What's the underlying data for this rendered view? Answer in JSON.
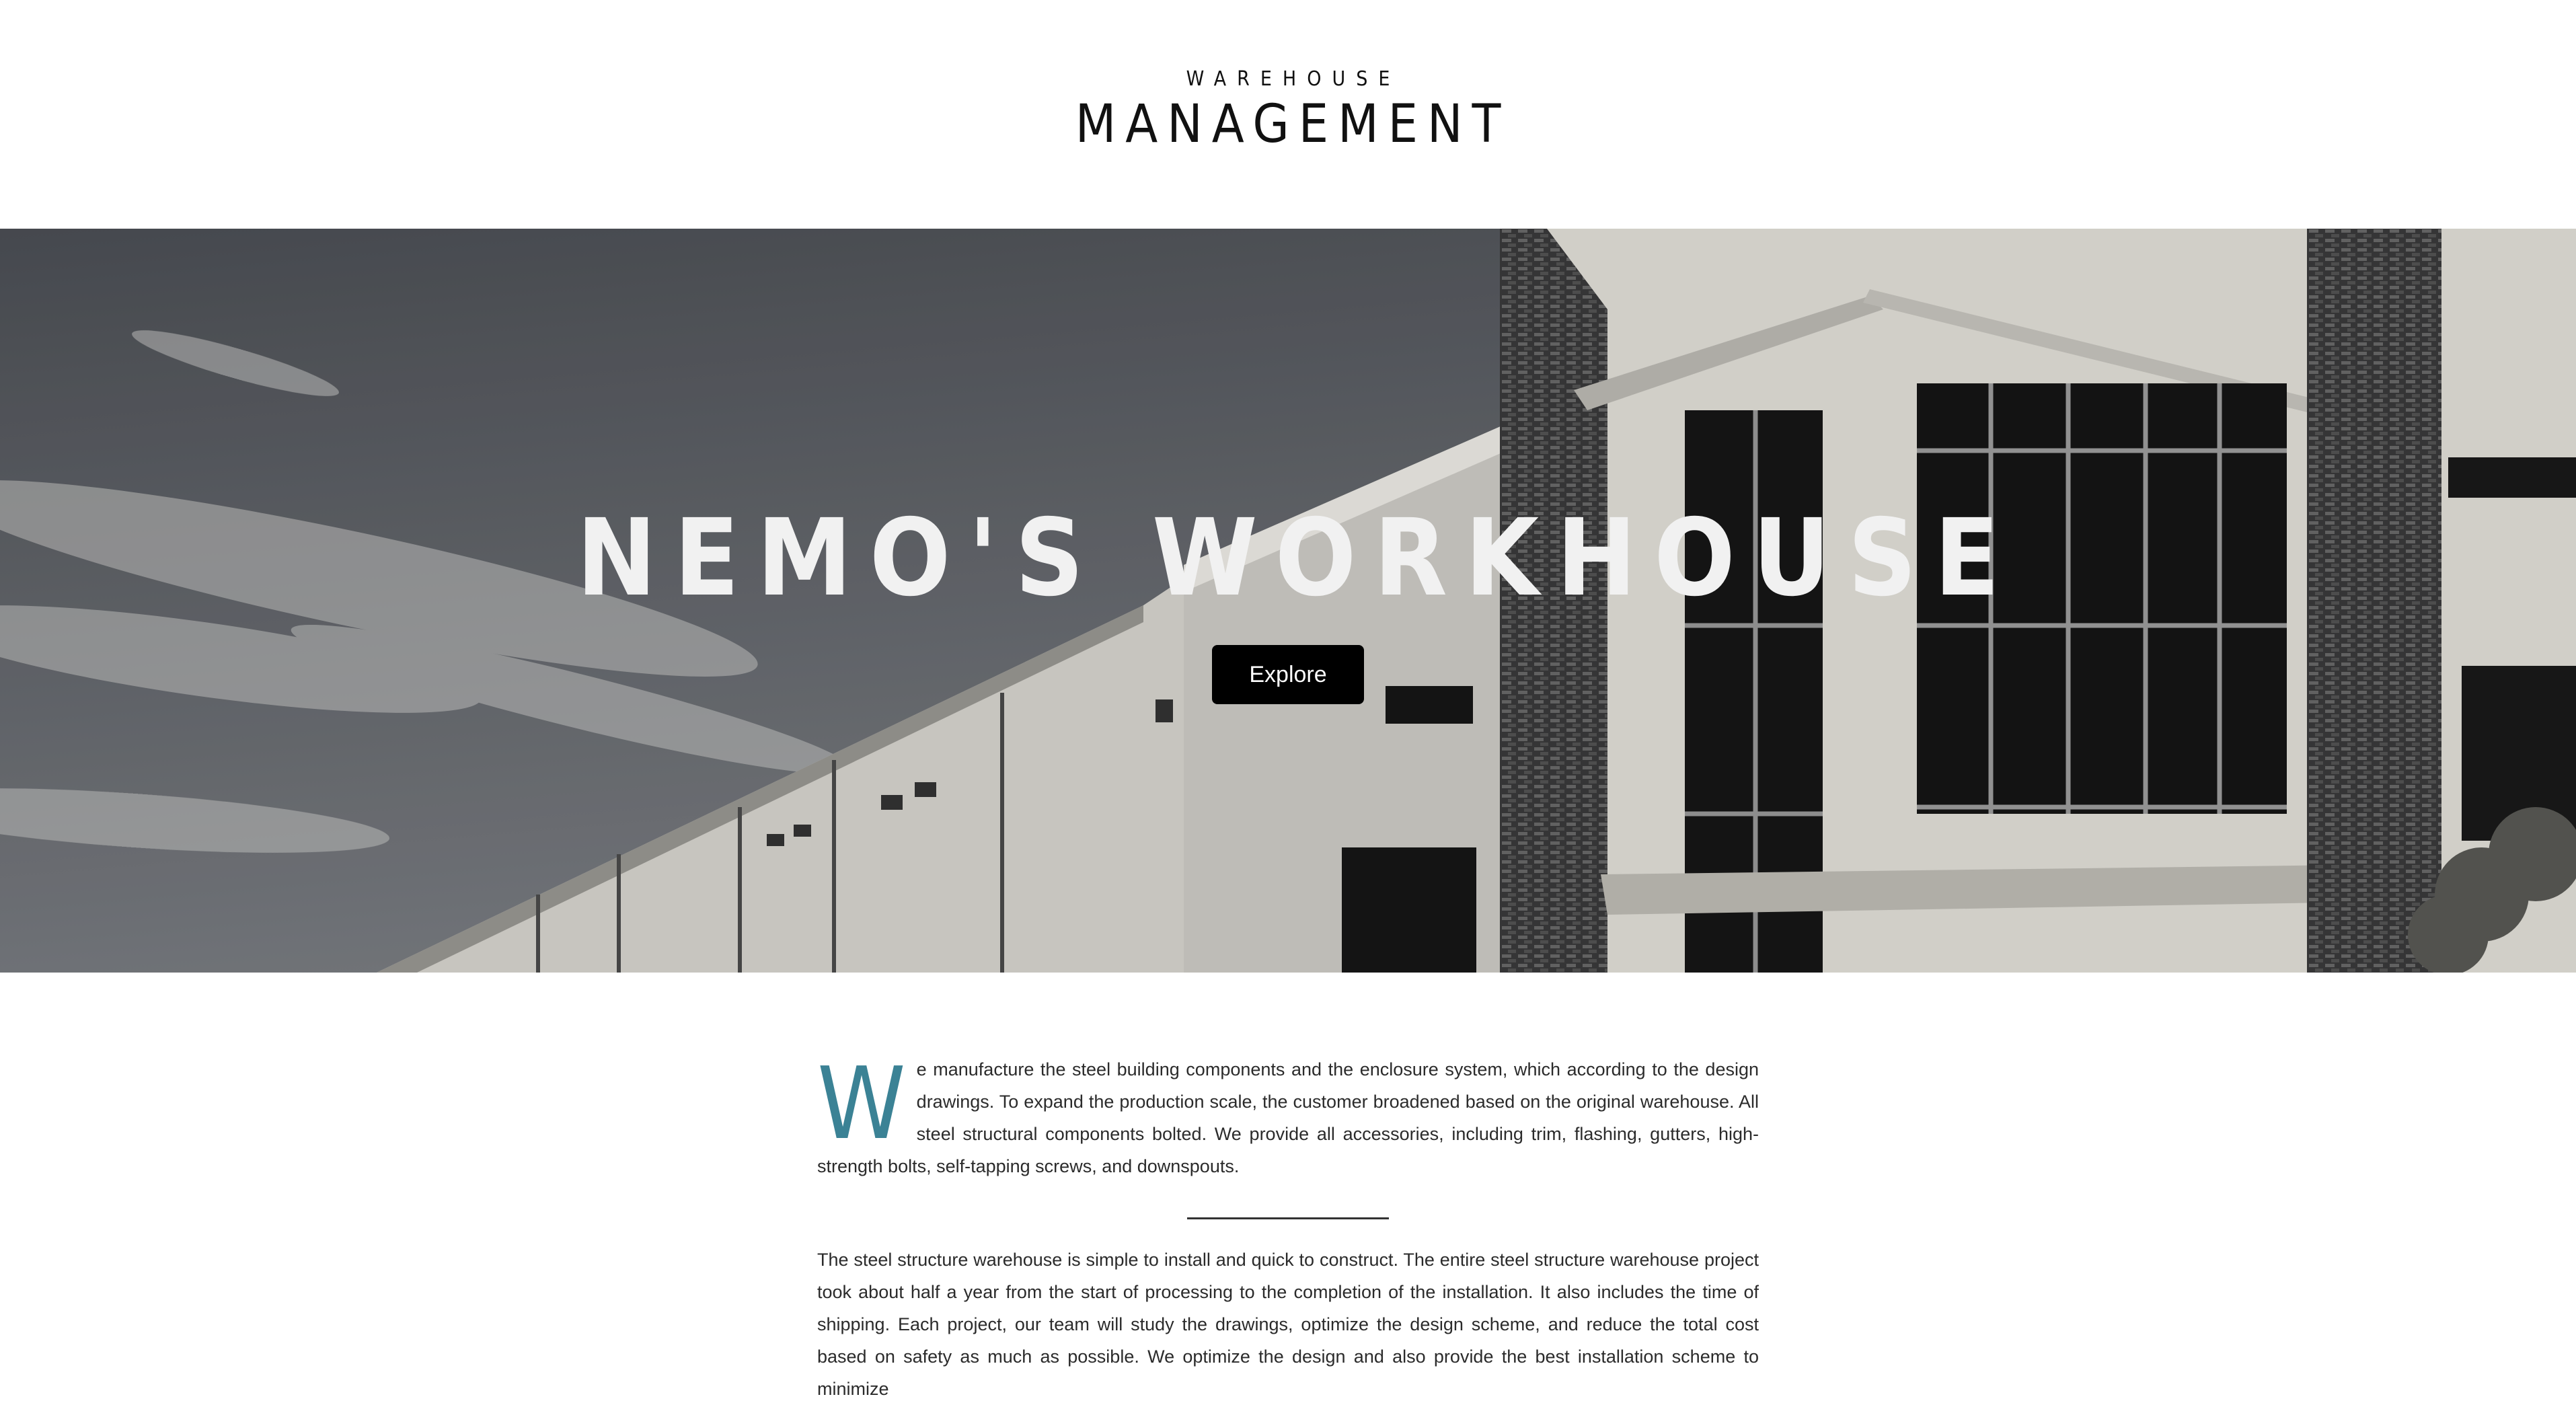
{
  "logo": {
    "small": "WAREHOUSE",
    "big": "MANAGEMENT"
  },
  "hero": {
    "title": "NEMO'S WORKHOUSE",
    "button_label": "Explore"
  },
  "article": {
    "dropcap": "W",
    "paragraph1": "e manufacture the steel building components and the enclosure system, which according to the design drawings. To expand the production scale, the customer broadened based on the original warehouse. All steel structural components bolted. We provide all accessories, including trim, flashing, gutters, high-strength bolts, self-tapping screws, and downspouts.",
    "paragraph2": "The steel structure warehouse is simple to install and quick to construct. The entire steel structure warehouse project took about half a year from the start of processing to the completion of the installation. It also includes the time of shipping. Each project, our team will study the drawings, optimize the design scheme, and reduce the total cost based on safety as much as possible. We optimize the design and also provide the best installation scheme to minimize"
  },
  "colors": {
    "dropcap": "#3b8295",
    "button_bg": "#000000"
  }
}
